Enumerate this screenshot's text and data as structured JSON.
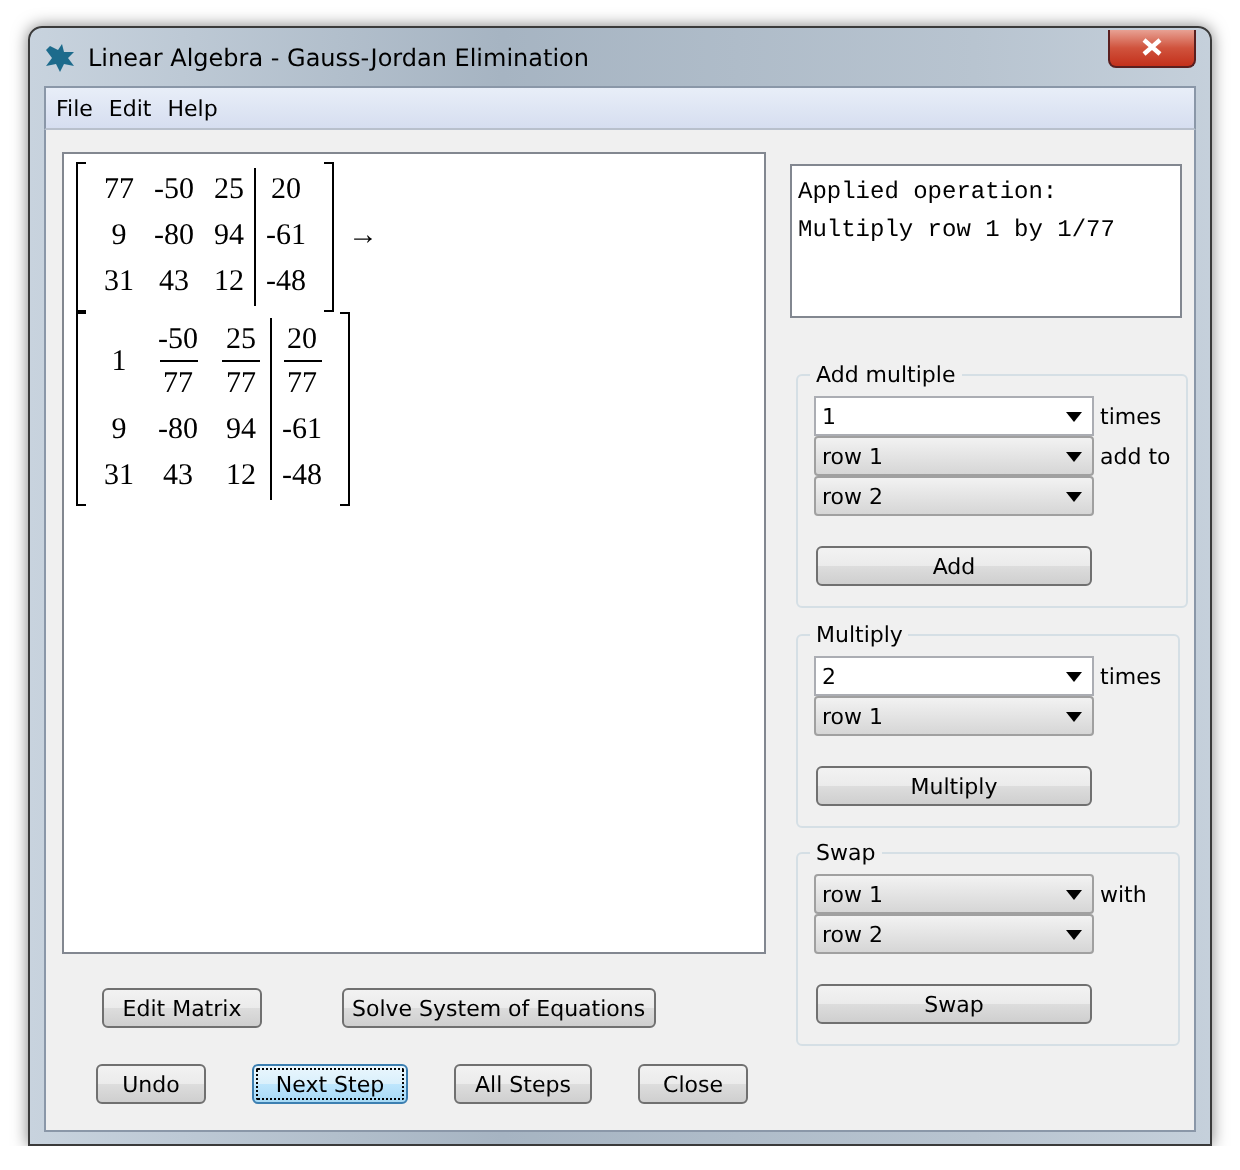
{
  "window": {
    "title": "Linear Algebra - Gauss-Jordan Elimination"
  },
  "menu": [
    "File",
    "Edit",
    "Help"
  ],
  "matrices": [
    {
      "arrow": "→",
      "rows": [
        {
          "coefficients": [
            {
              "kind": "number",
              "text": "77"
            },
            {
              "kind": "number",
              "text": "-50"
            },
            {
              "kind": "number",
              "text": "25"
            }
          ],
          "constant": {
            "kind": "number",
            "text": "20"
          }
        },
        {
          "coefficients": [
            {
              "kind": "number",
              "text": "9"
            },
            {
              "kind": "number",
              "text": "-80"
            },
            {
              "kind": "number",
              "text": "94"
            }
          ],
          "constant": {
            "kind": "number",
            "text": "-61"
          }
        },
        {
          "coefficients": [
            {
              "kind": "number",
              "text": "31"
            },
            {
              "kind": "number",
              "text": "43"
            },
            {
              "kind": "number",
              "text": "12"
            }
          ],
          "constant": {
            "kind": "number",
            "text": "-48"
          }
        }
      ]
    },
    {
      "rows": [
        {
          "coefficients": [
            {
              "kind": "number",
              "text": "1"
            },
            {
              "kind": "fraction",
              "numerator": "-50",
              "denominator": "77"
            },
            {
              "kind": "fraction",
              "numerator": "25",
              "denominator": "77"
            }
          ],
          "constant": {
            "kind": "fraction",
            "numerator": "20",
            "denominator": "77"
          }
        },
        {
          "coefficients": [
            {
              "kind": "number",
              "text": "9"
            },
            {
              "kind": "number",
              "text": "-80"
            },
            {
              "kind": "number",
              "text": "94"
            }
          ],
          "constant": {
            "kind": "number",
            "text": "-61"
          }
        },
        {
          "coefficients": [
            {
              "kind": "number",
              "text": "31"
            },
            {
              "kind": "number",
              "text": "43"
            },
            {
              "kind": "number",
              "text": "12"
            }
          ],
          "constant": {
            "kind": "number",
            "text": "-48"
          }
        }
      ]
    }
  ],
  "operation_log": [
    "Applied operation:",
    "Multiply row 1 by 1/77"
  ],
  "groups": [
    {
      "title": "Add multiple",
      "fields": [
        {
          "kind": "editable",
          "value": "1",
          "label": "times"
        },
        {
          "kind": "select",
          "value": "row 1",
          "label": "add to"
        },
        {
          "kind": "select",
          "value": "row 2"
        }
      ],
      "button": "Add"
    },
    {
      "title": "Multiply",
      "fields": [
        {
          "kind": "editable",
          "value": "2",
          "label": "times"
        },
        {
          "kind": "select",
          "value": "row 1"
        }
      ],
      "button": "Multiply"
    },
    {
      "title": "Swap",
      "fields": [
        {
          "kind": "select",
          "value": "row 1",
          "label": "with"
        },
        {
          "kind": "select",
          "value": "row 2"
        }
      ],
      "button": "Swap"
    }
  ],
  "button_rows": [
    [
      {
        "label": "Edit Matrix",
        "focused": false
      },
      {
        "label": "Solve System of Equations",
        "focused": false
      }
    ],
    [
      {
        "label": "Undo",
        "focused": false
      },
      {
        "label": "Next Step",
        "focused": true
      },
      {
        "label": "All Steps",
        "focused": false
      },
      {
        "label": "Close",
        "focused": false
      }
    ]
  ]
}
